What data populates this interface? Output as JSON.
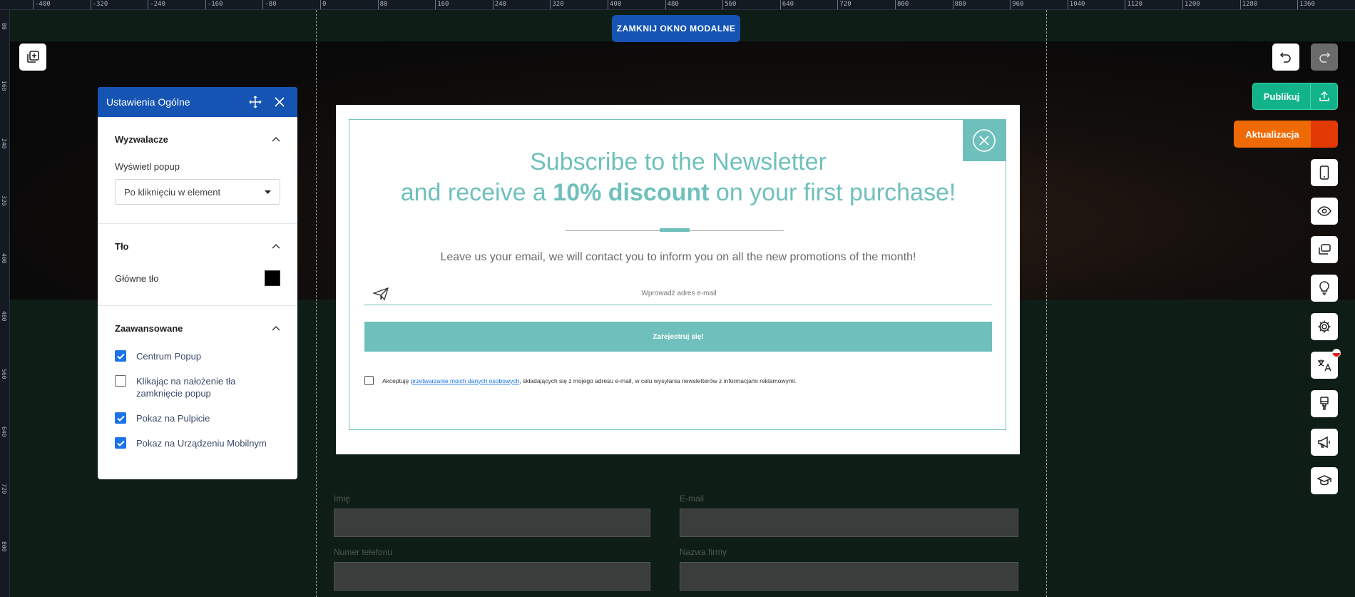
{
  "ruler": {
    "top_labels": [
      "-400",
      "-320",
      "-240",
      "-160",
      "-80",
      "0",
      "80",
      "160",
      "240",
      "320",
      "400",
      "480",
      "560",
      "640",
      "720",
      "800",
      "880",
      "960",
      "1040",
      "1120",
      "1200",
      "1280",
      "1360"
    ],
    "left_labels": [
      "80",
      "160",
      "240",
      "320",
      "400",
      "480",
      "560",
      "640",
      "720",
      "800"
    ]
  },
  "toolbar": {
    "close_modal_label": "ZAMKNIJ OKNO MODALNE",
    "publish_label": "Publikuj",
    "update_label": "Aktualizacja",
    "accent_publish": "#12b38b",
    "accent_update": "#ef6a05",
    "side_icons": [
      "mobile-icon",
      "eye-icon",
      "layers-icon",
      "lightbulb-icon",
      "gear-icon",
      "translate-icon",
      "brush-icon",
      "megaphone-icon",
      "graduation-cap-icon"
    ]
  },
  "panel": {
    "title": "Ustawienia Ogólne",
    "sections": {
      "triggers": {
        "title": "Wyzwalacze",
        "field_label": "Wyświetl popup",
        "select_value": "Po kliknięciu w element"
      },
      "background": {
        "title": "Tło",
        "field_label": "Główne tło",
        "color": "#000000"
      },
      "advanced": {
        "title": "Zaawansowane",
        "options": [
          {
            "label": "Centrum Popup",
            "checked": true
          },
          {
            "label": "Klikając na nałożenie tła zamknięcie popup",
            "checked": false
          },
          {
            "label": "Pokaz na Pulpicie",
            "checked": true
          },
          {
            "label": "Pokaz na Urządzeniu Mobilnym",
            "checked": true
          }
        ]
      }
    }
  },
  "popup": {
    "title_line1": "Subscribe to the Newsletter",
    "title_line2_pre": "and receive a ",
    "title_line2_bold": "10% discount",
    "title_line2_post": " on your first purchase!",
    "description": "Leave us your email, we will contact you to inform you on all the new promotions of the month!",
    "email_placeholder": "Wprowadź adres e-mail",
    "submit_label": "Zarejestruj się!",
    "consent_pre": "Akceptuję ",
    "consent_link": "przetwarzanie moich danych osobowych",
    "consent_post": ", składających się z mojego adresu e-mail, w celu wysyłania newsletterów z informacjami reklamowymi.",
    "accent": "#6fc0bc"
  },
  "background_form": {
    "labels": [
      "Imię",
      "E-mail",
      "Numer telefonu",
      "Nazwa firmy"
    ]
  }
}
